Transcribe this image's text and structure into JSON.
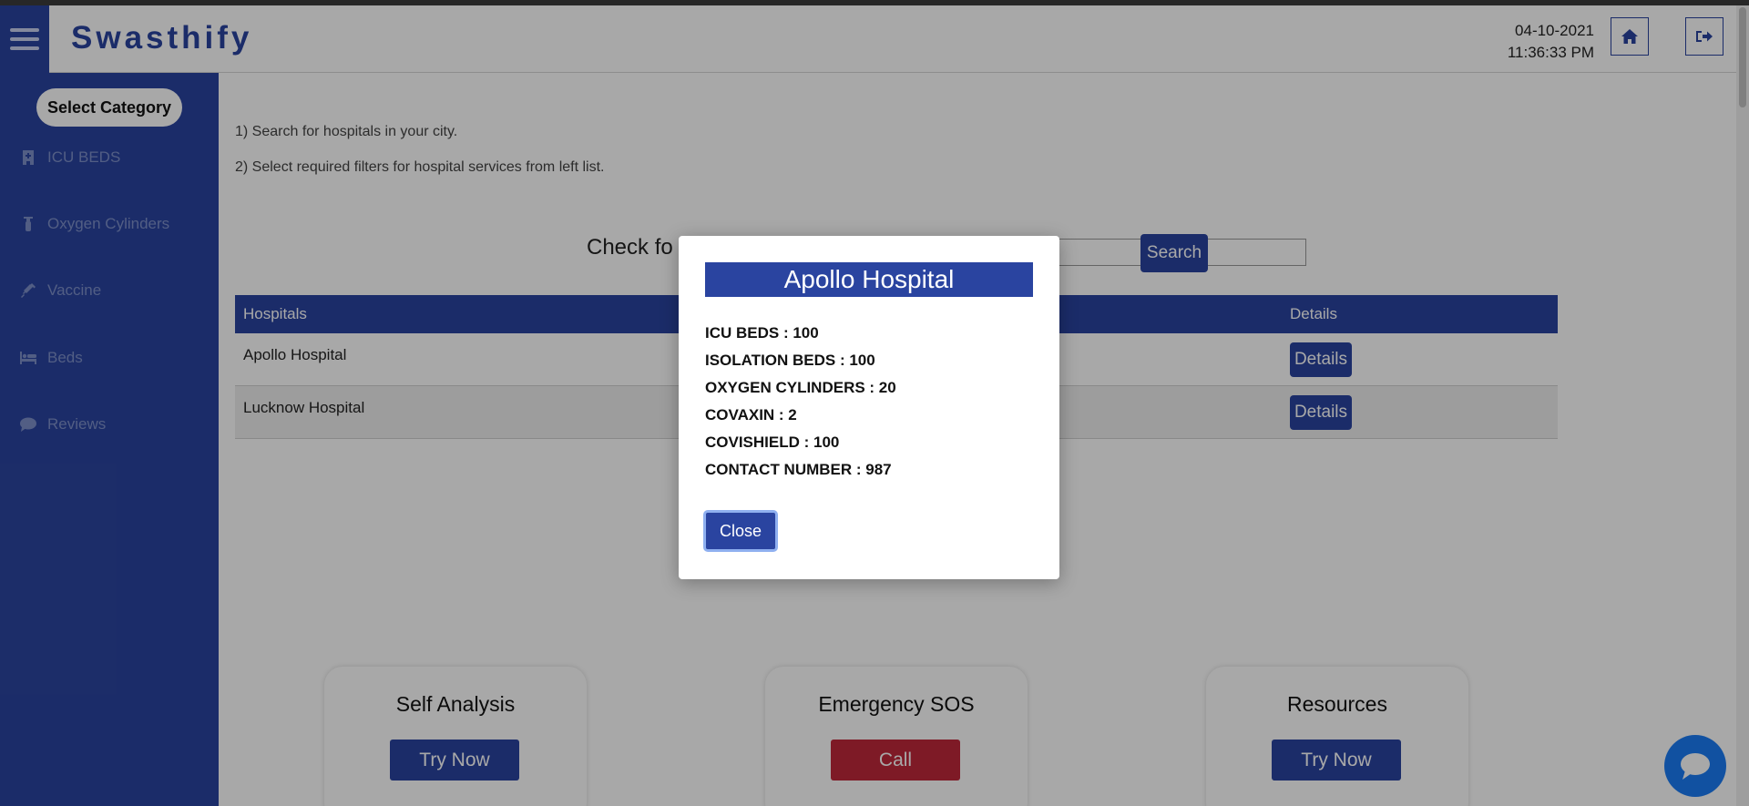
{
  "header": {
    "app_title": "Swasthify",
    "date": "04-10-2021",
    "time": "11:36:33 PM"
  },
  "icons": {
    "menu": "hamburger-icon",
    "home": "home-icon",
    "logout": "logout-icon",
    "chat": "chat-bubble-icon"
  },
  "sidebar": {
    "heading": "Select Category",
    "items": [
      {
        "label": "ICU BEDS",
        "icon": "hospital-icon"
      },
      {
        "label": "Oxygen Cylinders",
        "icon": "oxygen-cylinder-icon"
      },
      {
        "label": "Vaccine",
        "icon": "syringe-icon"
      },
      {
        "label": "Beds",
        "icon": "bed-icon"
      },
      {
        "label": "Reviews",
        "icon": "comment-icon"
      }
    ]
  },
  "main": {
    "instructions": [
      "1) Search for hospitals in your city.",
      "2) Select required filters for hospital services from left list."
    ],
    "search_label": "Check fo",
    "search_button": "Search",
    "table": {
      "columns": [
        "Hospitals",
        "Details"
      ],
      "rows": [
        {
          "name": "Apollo Hospital",
          "action": "Details"
        },
        {
          "name": "Lucknow Hospital",
          "action": "Details"
        }
      ]
    },
    "cards": [
      {
        "title": "Self Analysis",
        "button": "Try Now",
        "color": "#2a44a0"
      },
      {
        "title": "Emergency SOS",
        "button": "Call",
        "color": "#c0283a"
      },
      {
        "title": "Resources",
        "button": "Try Now",
        "color": "#2a44a0"
      }
    ]
  },
  "modal": {
    "title": "Apollo Hospital",
    "lines": [
      "ICU BEDS : 100",
      "ISOLATION BEDS : 100",
      "OXYGEN CYLINDERS : 20",
      "COVAXIN : 2",
      "COVISHIELD : 100",
      "CONTACT NUMBER : 987"
    ],
    "close_button": "Close"
  },
  "colors": {
    "primary": "#2a44a0",
    "danger": "#c0283a",
    "chat": "#1a7cf5"
  }
}
